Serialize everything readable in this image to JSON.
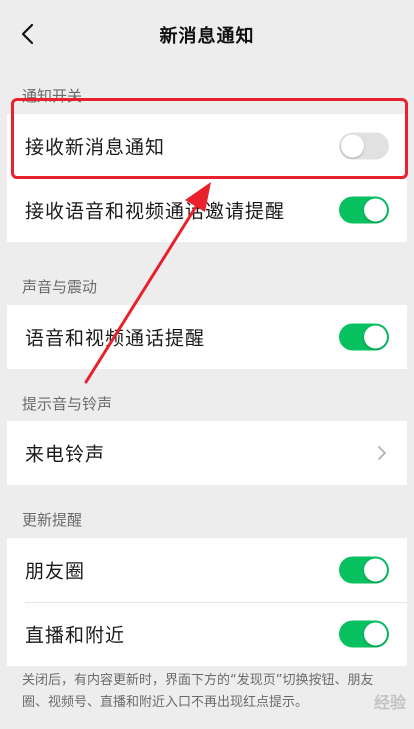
{
  "header": {
    "title": "新消息通知"
  },
  "sections": [
    {
      "label": "通知开关",
      "rows": [
        {
          "label": "接收新消息通知",
          "control": "toggle",
          "on": false
        },
        {
          "label": "接收语音和视频通话邀请提醒",
          "control": "toggle",
          "on": true
        }
      ]
    },
    {
      "label": "声音与震动",
      "rows": [
        {
          "label": "语音和视频通话提醒",
          "control": "toggle",
          "on": true
        }
      ]
    },
    {
      "label": "提示音与铃声",
      "rows": [
        {
          "label": "来电铃声",
          "control": "chevron"
        }
      ]
    },
    {
      "label": "更新提醒",
      "rows": [
        {
          "label": "朋友圈",
          "control": "toggle",
          "on": true
        },
        {
          "label": "直播和附近",
          "control": "toggle",
          "on": true
        }
      ]
    }
  ],
  "footer": {
    "note": "关闭后，有内容更新时，界面下方的“发现页”切换按钮、朋友圈、视频号、直播和附近入口不再出现红点提示。"
  },
  "watermark": "经验",
  "colors": {
    "toggle_on": "#07c160",
    "toggle_off": "#e1e1e1",
    "annotation": "#e8212c",
    "background": "#ededed"
  },
  "icons": {
    "back": "chevron-left-icon",
    "chevron": "chevron-right-icon"
  }
}
